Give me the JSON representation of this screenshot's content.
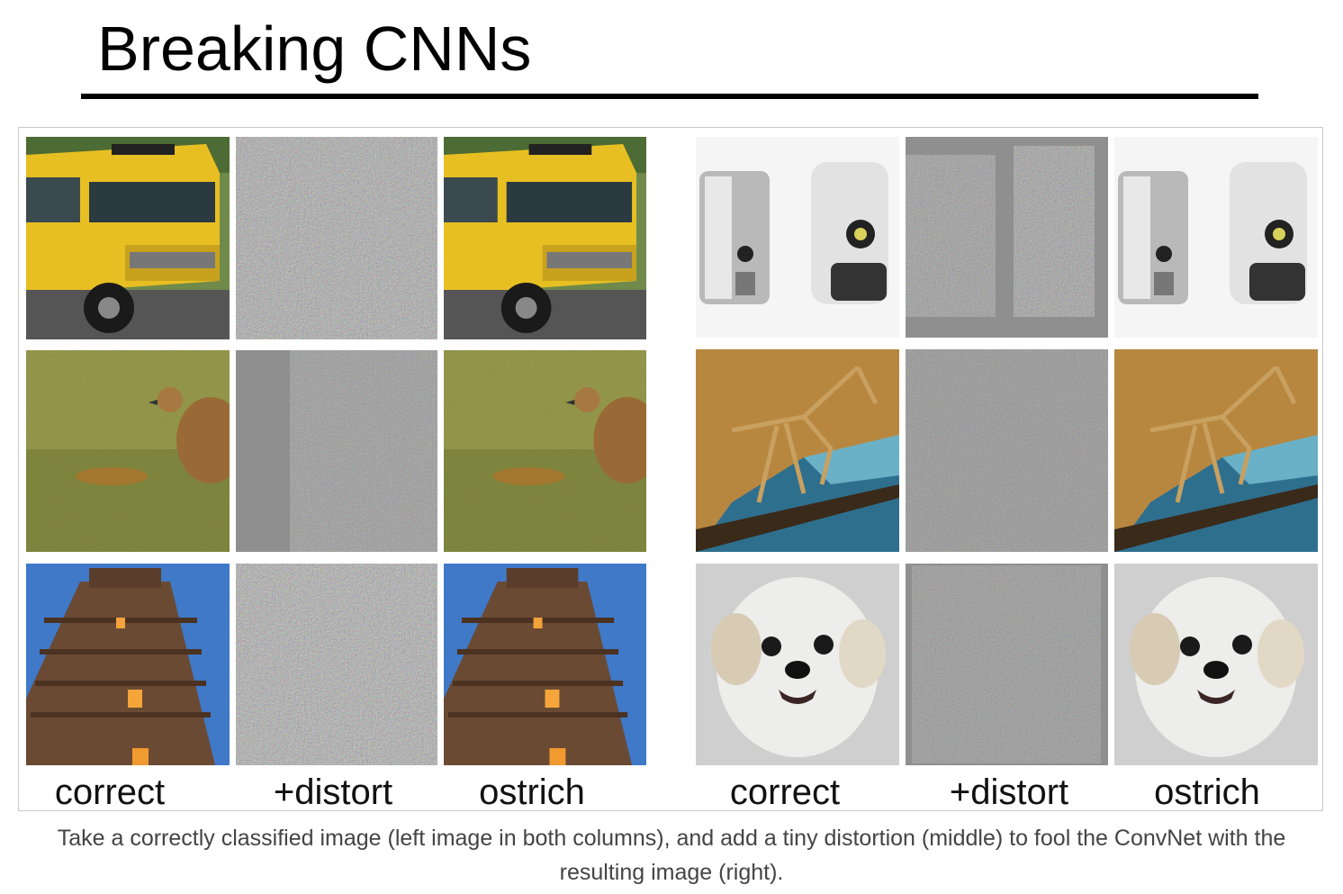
{
  "slide": {
    "title": "Breaking CNNs"
  },
  "figure": {
    "column_labels_left": [
      "correct",
      "+distort",
      "ostrich"
    ],
    "column_labels_right": [
      "correct",
      "+distort",
      "ostrich"
    ],
    "rows_left": [
      {
        "subject": "school bus",
        "icon": "school-bus-photo"
      },
      {
        "subject": "bird in grass",
        "icon": "bird-photo"
      },
      {
        "subject": "temple tower",
        "icon": "temple-photo"
      }
    ],
    "rows_right": [
      {
        "subject": "soap dispensers",
        "icon": "dispenser-photo"
      },
      {
        "subject": "praying mantis",
        "icon": "mantis-photo"
      },
      {
        "subject": "white dog",
        "icon": "dog-photo"
      }
    ],
    "noise_color": "#8f8f8f"
  },
  "caption": {
    "line1": "Take a correctly classified image (left image in both columns), and add a tiny distortion (middle) to fool the ConvNet with the",
    "line2": "resulting image (right)."
  }
}
